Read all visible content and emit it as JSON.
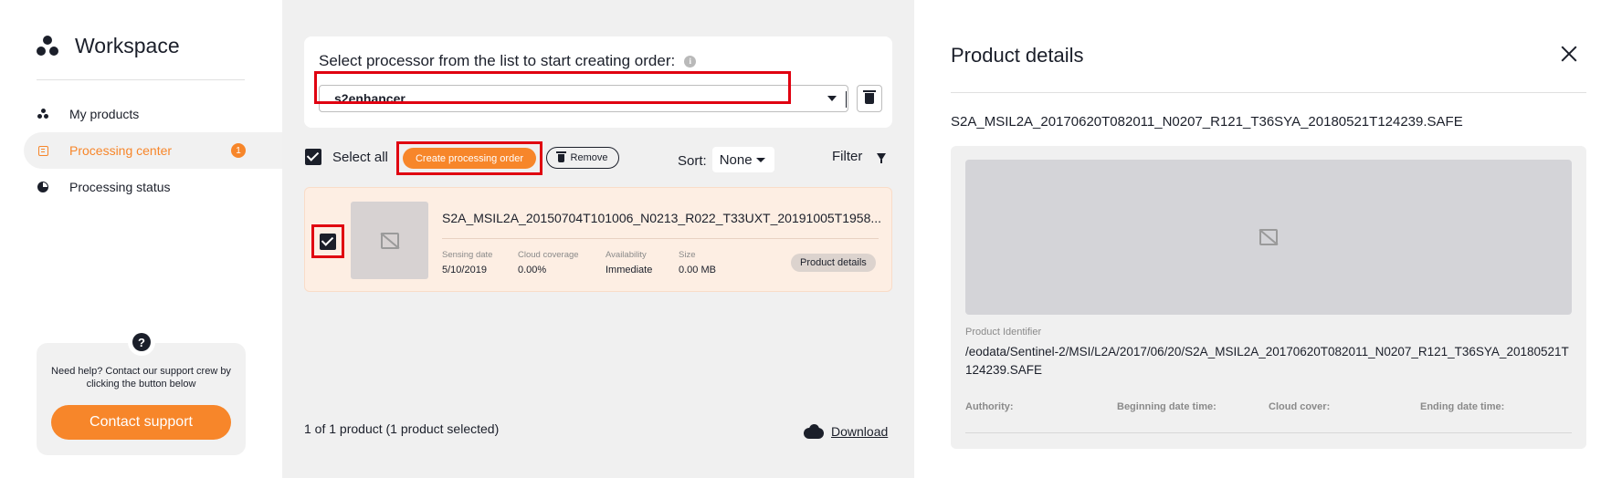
{
  "sidebar": {
    "brand": "Workspace",
    "items": [
      {
        "label": "My products",
        "icon": "workspace-dots-icon"
      },
      {
        "label": "Processing center",
        "icon": "list-icon",
        "badge": "1",
        "active": true
      },
      {
        "label": "Processing status",
        "icon": "pie-chart-icon"
      }
    ],
    "help": {
      "text": "Need help? Contact our support crew by clicking the button below",
      "button": "Contact support"
    }
  },
  "main": {
    "processor_label": "Select processor from the list to start creating order:",
    "processor_value": "s2enhancer",
    "toolbar": {
      "select_all": "Select all",
      "create_order": "Create processing order",
      "remove": "Remove",
      "sort_label": "Sort:",
      "sort_value": "None",
      "filter": "Filter"
    },
    "product": {
      "name": "S2A_MSIL2A_20150704T101006_N0213_R022_T33UXT_20191005T1958...",
      "meta": [
        {
          "key": "Sensing date",
          "value": "5/10/2019"
        },
        {
          "key": "Cloud coverage",
          "value": "0.00%"
        },
        {
          "key": "Availability",
          "value": "Immediate"
        },
        {
          "key": "Size",
          "value": "0.00 MB"
        }
      ],
      "details_button": "Product details",
      "selected": true
    },
    "result_count": "1 of 1 product (1 product selected)",
    "download": "Download"
  },
  "panel": {
    "title": "Product details",
    "product_name": "S2A_MSIL2A_20170620T082011_N0207_R121_T36SYA_20180521T124239.SAFE",
    "identifier_label": "Product Identifier",
    "identifier_value": "/eodata/Sentinel-2/MSI/L2A/2017/06/20/S2A_MSIL2A_20170620T082011_N0207_R121_T36SYA_20180521T124239.SAFE",
    "attributes": [
      "Authority:",
      "Beginning date time:",
      "Cloud cover:",
      "Ending date time:"
    ]
  },
  "colors": {
    "accent": "#f7862a",
    "highlight": "#e00010",
    "text": "#1b1f2a"
  }
}
